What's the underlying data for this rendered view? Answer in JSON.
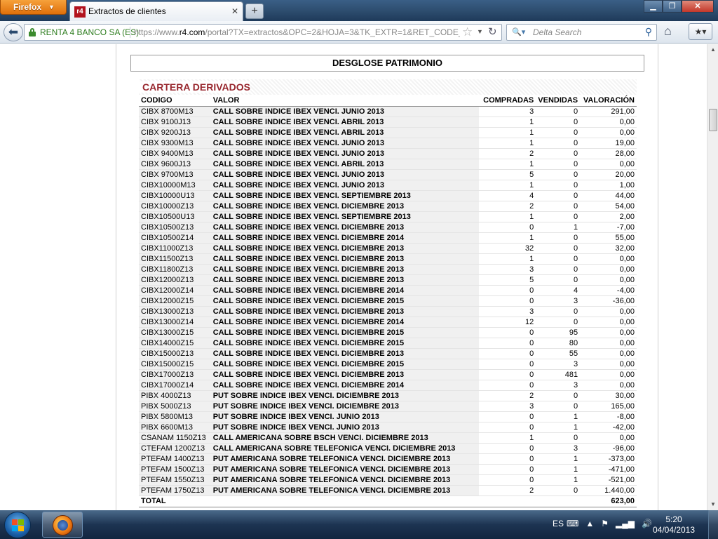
{
  "browser": {
    "menu_button": "Firefox",
    "tab_title": "Extractos de clientes",
    "tab_favicon": "r4",
    "identity": "RENTA 4 BANCO SA (ES)",
    "url_prefix": "https://www.",
    "url_domain": "r4.com",
    "url_rest": "/portal?TX=extractos&OPC=2&HOJA=3&TK_EXTR=1&RET_CODE_A",
    "search_placeholder": "Delta Search"
  },
  "page": {
    "section_title": "DESGLOSE PATRIMONIO",
    "table_title": "CARTERA DERIVADOS",
    "columns": [
      "CODIGO",
      "VALOR",
      "COMPRADAS",
      "VENDIDAS",
      "VALORACIÓN"
    ],
    "rows": [
      [
        "CIBX 8700M13",
        "CALL SOBRE INDICE IBEX VENCI. JUNIO 2013",
        "3",
        "0",
        "291,00"
      ],
      [
        "CIBX 9100J13",
        "CALL SOBRE INDICE IBEX VENCI. ABRIL 2013",
        "1",
        "0",
        "0,00"
      ],
      [
        "CIBX 9200J13",
        "CALL SOBRE INDICE IBEX VENCI. ABRIL 2013",
        "1",
        "0",
        "0,00"
      ],
      [
        "CIBX 9300M13",
        "CALL SOBRE INDICE IBEX VENCI. JUNIO 2013",
        "1",
        "0",
        "19,00"
      ],
      [
        "CIBX 9400M13",
        "CALL SOBRE INDICE IBEX VENCI. JUNIO 2013",
        "2",
        "0",
        "28,00"
      ],
      [
        "CIBX 9600J13",
        "CALL SOBRE INDICE IBEX VENCI. ABRIL 2013",
        "1",
        "0",
        "0,00"
      ],
      [
        "CIBX 9700M13",
        "CALL SOBRE INDICE IBEX VENCI. JUNIO 2013",
        "5",
        "0",
        "20,00"
      ],
      [
        "CIBX10000M13",
        "CALL SOBRE INDICE IBEX VENCI. JUNIO 2013",
        "1",
        "0",
        "1,00"
      ],
      [
        "CIBX10000U13",
        "CALL SOBRE INDICE IBEX VENCI. SEPTIEMBRE 2013",
        "4",
        "0",
        "44,00"
      ],
      [
        "CIBX10000Z13",
        "CALL SOBRE INDICE IBEX VENCI. DICIEMBRE 2013",
        "2",
        "0",
        "54,00"
      ],
      [
        "CIBX10500U13",
        "CALL SOBRE INDICE IBEX VENCI. SEPTIEMBRE 2013",
        "1",
        "0",
        "2,00"
      ],
      [
        "CIBX10500Z13",
        "CALL SOBRE INDICE IBEX VENCI. DICIEMBRE 2013",
        "0",
        "1",
        "-7,00"
      ],
      [
        "CIBX10500Z14",
        "CALL SOBRE INDICE IBEX VENCI. DICIEMBRE 2014",
        "1",
        "0",
        "55,00"
      ],
      [
        "CIBX11000Z13",
        "CALL SOBRE INDICE IBEX VENCI. DICIEMBRE 2013",
        "32",
        "0",
        "32,00"
      ],
      [
        "CIBX11500Z13",
        "CALL SOBRE INDICE IBEX VENCI. DICIEMBRE 2013",
        "1",
        "0",
        "0,00"
      ],
      [
        "CIBX11800Z13",
        "CALL SOBRE INDICE IBEX VENCI. DICIEMBRE 2013",
        "3",
        "0",
        "0,00"
      ],
      [
        "CIBX12000Z13",
        "CALL SOBRE INDICE IBEX VENCI. DICIEMBRE 2013",
        "5",
        "0",
        "0,00"
      ],
      [
        "CIBX12000Z14",
        "CALL SOBRE INDICE IBEX VENCI. DICIEMBRE 2014",
        "0",
        "4",
        "-4,00"
      ],
      [
        "CIBX12000Z15",
        "CALL SOBRE INDICE IBEX VENCI. DICIEMBRE 2015",
        "0",
        "3",
        "-36,00"
      ],
      [
        "CIBX13000Z13",
        "CALL SOBRE INDICE IBEX VENCI. DICIEMBRE 2013",
        "3",
        "0",
        "0,00"
      ],
      [
        "CIBX13000Z14",
        "CALL SOBRE INDICE IBEX VENCI. DICIEMBRE 2014",
        "12",
        "0",
        "0,00"
      ],
      [
        "CIBX13000Z15",
        "CALL SOBRE INDICE IBEX VENCI. DICIEMBRE 2015",
        "0",
        "95",
        "0,00"
      ],
      [
        "CIBX14000Z15",
        "CALL SOBRE INDICE IBEX VENCI. DICIEMBRE 2015",
        "0",
        "80",
        "0,00"
      ],
      [
        "CIBX15000Z13",
        "CALL SOBRE INDICE IBEX VENCI. DICIEMBRE 2013",
        "0",
        "55",
        "0,00"
      ],
      [
        "CIBX15000Z15",
        "CALL SOBRE INDICE IBEX VENCI. DICIEMBRE 2015",
        "0",
        "3",
        "0,00"
      ],
      [
        "CIBX17000Z13",
        "CALL SOBRE INDICE IBEX VENCI. DICIEMBRE 2013",
        "0",
        "481",
        "0,00"
      ],
      [
        "CIBX17000Z14",
        "CALL SOBRE INDICE IBEX VENCI. DICIEMBRE 2014",
        "0",
        "3",
        "0,00"
      ],
      [
        "PIBX 4000Z13",
        "PUT SOBRE INDICE IBEX VENCI. DICIEMBRE 2013",
        "2",
        "0",
        "30,00"
      ],
      [
        "PIBX 5000Z13",
        "PUT SOBRE INDICE IBEX VENCI. DICIEMBRE 2013",
        "3",
        "0",
        "165,00"
      ],
      [
        "PIBX 5800M13",
        "PUT SOBRE INDICE IBEX VENCI. JUNIO 2013",
        "0",
        "1",
        "-8,00"
      ],
      [
        "PIBX 6600M13",
        "PUT SOBRE INDICE IBEX VENCI. JUNIO 2013",
        "0",
        "1",
        "-42,00"
      ],
      [
        "CSANAM 1150Z13",
        "CALL AMERICANA SOBRE BSCH VENCI. DICIEMBRE 2013",
        "1",
        "0",
        "0,00"
      ],
      [
        "CTEFAM 1200Z13",
        "CALL AMERICANA SOBRE TELEFONICA VENCI. DICIEMBRE 2013",
        "0",
        "3",
        "-96,00"
      ],
      [
        "PTEFAM 1400Z13",
        "PUT AMERICANA SOBRE TELEFONICA VENCI. DICIEMBRE 2013",
        "0",
        "1",
        "-373,00"
      ],
      [
        "PTEFAM 1500Z13",
        "PUT AMERICANA SOBRE TELEFONICA VENCI. DICIEMBRE 2013",
        "0",
        "1",
        "-471,00"
      ],
      [
        "PTEFAM 1550Z13",
        "PUT AMERICANA SOBRE TELEFONICA VENCI. DICIEMBRE 2013",
        "0",
        "1",
        "-521,00"
      ],
      [
        "PTEFAM 1750Z13",
        "PUT AMERICANA SOBRE TELEFONICA VENCI. DICIEMBRE 2013",
        "2",
        "0",
        "1.440,00"
      ]
    ],
    "total_label": "TOTAL",
    "total_value": "623,00"
  },
  "taskbar": {
    "language": "ES",
    "time": "5:20",
    "date": "04/04/2013"
  },
  "colors": {
    "table_title": "#98272e",
    "identity_green": "#2e7d1f"
  }
}
